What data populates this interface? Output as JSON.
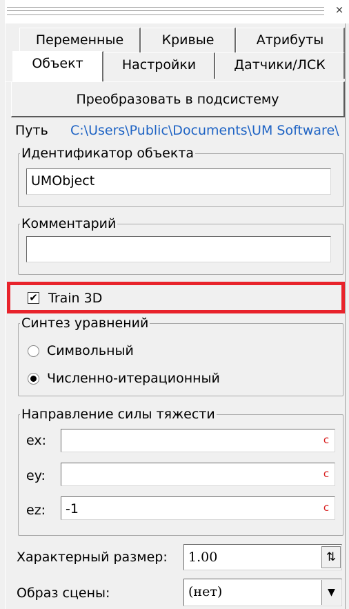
{
  "window": {
    "close_glyph": "×"
  },
  "tabs": {
    "row_top": [
      "Переменные",
      "Кривые",
      "Атрибуты"
    ],
    "row_bottom": [
      "Объект",
      "Настройки",
      "Датчики/ЛСК"
    ],
    "active": "Объект"
  },
  "convert_button": "Преобразовать в подсистему",
  "path": {
    "label": "Путь",
    "value": "C:\\Users\\Public\\Documents\\UM Software\\"
  },
  "object_id": {
    "legend": "Идентификатор объекта",
    "value": "UMObject"
  },
  "comment": {
    "legend": "Комментарий",
    "value": ""
  },
  "train3d": {
    "label": "Train 3D",
    "checked": true,
    "highlight_color": "#e8232b"
  },
  "equations": {
    "legend": "Синтез уравнений",
    "options": [
      "Символьный",
      "Численно-итерационный"
    ],
    "selected_index": 1
  },
  "gravity": {
    "legend": "Направление силы тяжести",
    "ex_label": "ex:",
    "ex_value": "",
    "ey_label": "ey:",
    "ey_value": "",
    "ez_label": "ez:",
    "ez_value": "-1",
    "clear_glyph": "c"
  },
  "char_size": {
    "label": "Характерный размер:",
    "value": "1.00"
  },
  "scene_image": {
    "label": "Образ сцены:",
    "value": "(нет)"
  },
  "icons": [
    "close-icon",
    "checkmark-icon",
    "spin-icon",
    "chevron-down-icon"
  ]
}
